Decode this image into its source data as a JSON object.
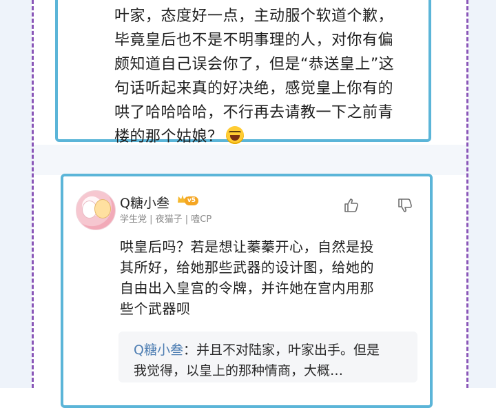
{
  "post_card": {
    "lines": [
      "叶家，态度好一点，主动服个软道个歉，",
      "毕竟皇后也不是不明事理的人，对你有偏",
      "颇知道自己误会你了，但是“恭送皇上”这",
      "句话听起来真的好决绝，感觉皇上你有的",
      "哄了哈哈哈哈，不行再去请教一下之前青",
      "楼的那个姑娘？"
    ],
    "emoji": "laughing-emoji"
  },
  "comment": {
    "username": "Q糖小叁",
    "badge": "v5",
    "tags": "学生党 | 夜猫子 | 嗑CP",
    "body_lines": [
      "哄皇后吗？若是想让蓁蓁开心，自然是投",
      "其所好，给她那些武器的设计图，给她的",
      "自由出入皇宫的令牌，并许她在宫内用那",
      "些个武器呗"
    ],
    "reply": {
      "author": "Q糖小叁",
      "separator": "：",
      "line1": "并且不对陆家，叶家出手。但是",
      "line2": "我觉得，以皇上的那种情商，大概…"
    }
  },
  "colors": {
    "card_border": "#5bb5d8",
    "dash": "#8a56b8",
    "reply_name": "#4f7fb3"
  }
}
